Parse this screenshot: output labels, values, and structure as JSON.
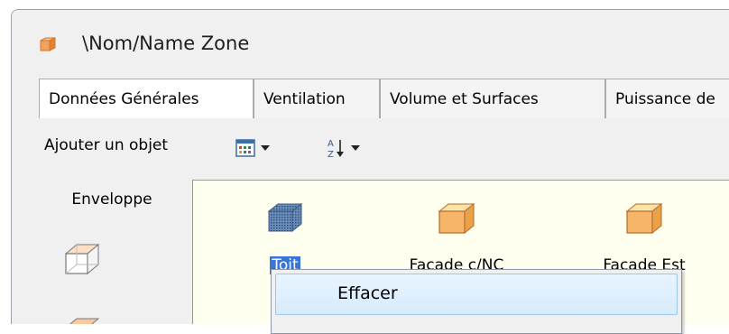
{
  "window": {
    "title": "\\Nom/Name Zone"
  },
  "tabs": [
    {
      "label": "Données Générales",
      "active": true
    },
    {
      "label": "Ventilation",
      "active": false
    },
    {
      "label": "Volume et Surfaces",
      "active": false
    },
    {
      "label": "Puissance de",
      "active": false
    }
  ],
  "toolbar": {
    "add_object_label": "Ajouter un objet",
    "view_icon": "grid-view-icon",
    "sort_icon": "sort-az-icon"
  },
  "side_panel": {
    "header": "Enveloppe"
  },
  "items": [
    {
      "label": "Toit",
      "icon": "roof-block-icon",
      "selected": true
    },
    {
      "label": "Facade c/NC",
      "icon": "wall-block-icon",
      "selected": false
    },
    {
      "label": "Facade Est",
      "icon": "wall-block-icon",
      "selected": false
    }
  ],
  "context_menu": {
    "items": [
      {
        "label": "Effacer"
      }
    ]
  },
  "colors": {
    "selection": "#3875d7",
    "panel_bg": "#fffff0",
    "menu_highlight": "#d6ebfc"
  }
}
